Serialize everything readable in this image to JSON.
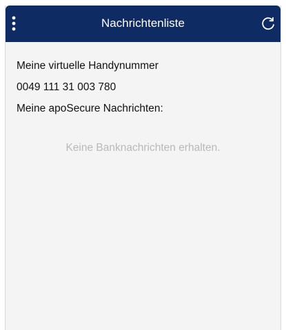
{
  "header": {
    "title": "Nachrichtenliste",
    "menu_icon": "kebab-menu-icon",
    "refresh_icon": "refresh-icon",
    "background_color": "#0f2b63"
  },
  "main": {
    "phone_label": "Meine virtuelle Handynummer",
    "phone_number": "0049 111 31 003 780",
    "messages_label": "Meine apoSecure Nachrichten:",
    "empty_message": "Keine Banknachrichten erhalten."
  }
}
